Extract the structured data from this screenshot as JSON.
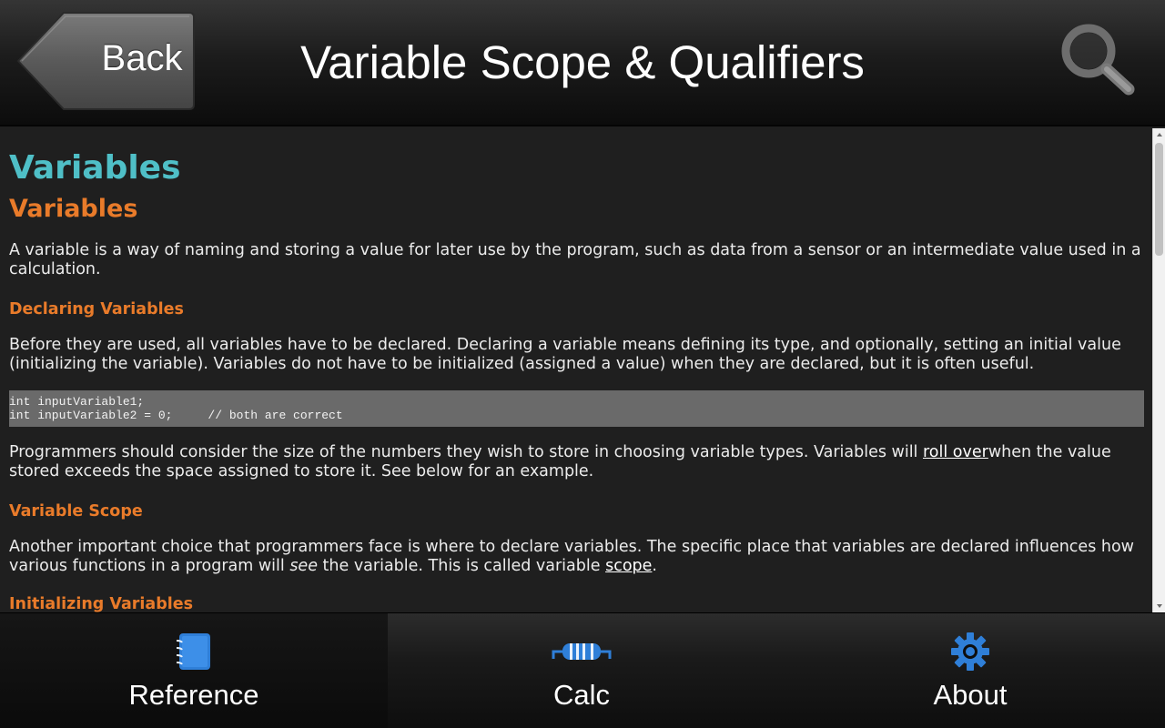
{
  "header": {
    "back_label": "Back",
    "title": "Variable Scope & Qualifiers"
  },
  "content": {
    "h1": "Variables",
    "h2": "Variables",
    "intro": "A variable is a way of naming and storing a value for later use by the program, such as data from a sensor or an intermediate value used in a calculation.",
    "declaring_heading": "Declaring Variables",
    "declaring_text": "Before they are used, all variables have to be declared. Declaring a variable means defining its type, and optionally, setting an initial value (initializing the variable). Variables do not have to be initialized (assigned a value) when they are declared, but it is often useful.",
    "code_line1": "int inputVariable1;",
    "code_line2": "int inputVariable2 = 0;     // both are correct",
    "size_text_before": "Programmers should consider the size of the numbers they wish to store in choosing variable types. Variables will ",
    "size_link": "roll over",
    "size_text_after": "when the value stored exceeds the space assigned to store it. See below for an example.",
    "scope_heading": "Variable Scope",
    "scope_text_before": "Another important choice that programmers face is where to declare variables. The specific place that variables are declared influences how various functions in a program will ",
    "scope_em": "see",
    "scope_text_middle": " the variable. This is called variable ",
    "scope_link": "scope",
    "scope_text_after": ".",
    "next_heading": "Initializing Variables"
  },
  "tabs": [
    {
      "label": "Reference",
      "icon": "notebook-icon"
    },
    {
      "label": "Calc",
      "icon": "resistor-icon"
    },
    {
      "label": "About",
      "icon": "gear-icon"
    }
  ],
  "colors": {
    "h1": "#4fbfc7",
    "heading_accent": "#e97b2a",
    "icon_blue": "#2f7fd8"
  }
}
